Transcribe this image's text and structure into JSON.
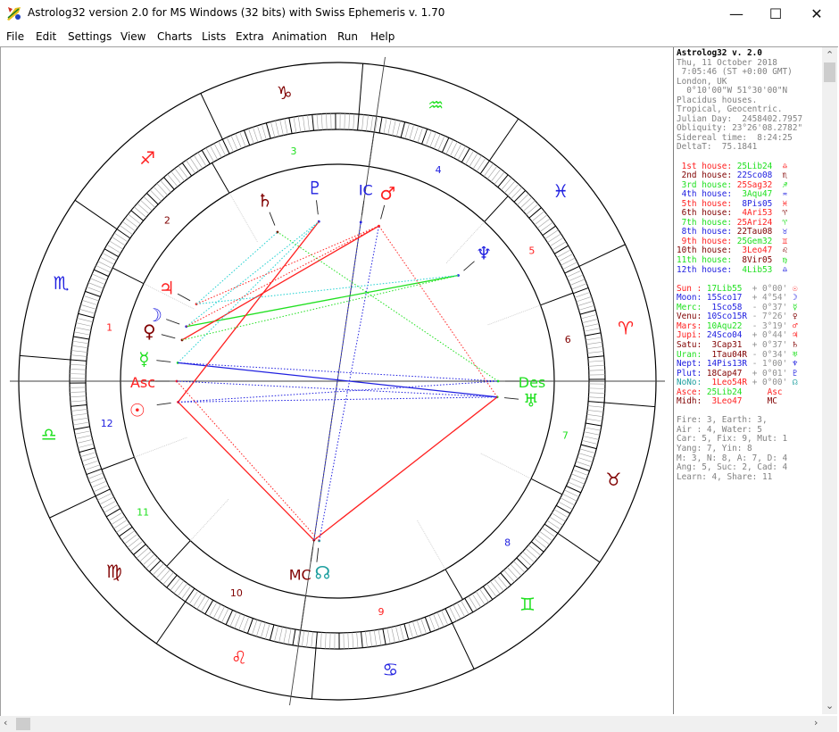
{
  "window": {
    "title": "Astrolog32 version 2.0 for MS Windows (32 bits) with Swiss Ephemeris v. 1.70",
    "controls": {
      "minimize": "—",
      "maximize": "☐",
      "close": "✕"
    }
  },
  "menu": [
    "File",
    "Edit",
    "Settings",
    "View",
    "Charts",
    "Lists",
    "Extra",
    "Animation",
    "Run",
    "Help"
  ],
  "info": {
    "header": [
      {
        "text": "Astrolog32 v. 2.0",
        "color": "#000000",
        "bold": true
      },
      {
        "text": "Thu, 11 October 2018",
        "color": "#808080"
      },
      {
        "text": " 7:05:46 (ST +0:00 GMT)",
        "color": "#808080"
      },
      {
        "text": "London, UK",
        "color": "#808080"
      },
      {
        "text": "  0°10'00\"W 51°30'00\"N",
        "color": "#808080"
      },
      {
        "text": "Placidus houses.",
        "color": "#808080"
      },
      {
        "text": "Tropical, Geocentric.",
        "color": "#808080"
      },
      {
        "text": "Julian Day:  2458402.7957",
        "color": "#808080"
      },
      {
        "text": "Obliquity: 23°26'08.2782\"",
        "color": "#808080"
      },
      {
        "text": "Sidereal time:  8:24:25",
        "color": "#808080"
      },
      {
        "text": "DeltaT:  75.1841",
        "color": "#808080"
      }
    ],
    "houses": [
      {
        "label": " 1st house:",
        "value": "25Lib24",
        "glyph": "♎",
        "lc": "#ff2020",
        "vc": "#20e020",
        "gc": "#ff2020"
      },
      {
        "label": " 2nd house:",
        "value": "22Sco08",
        "glyph": "♏",
        "lc": "#800000",
        "vc": "#2020e0",
        "gc": "#800000"
      },
      {
        "label": " 3rd house:",
        "value": "25Sag32",
        "glyph": "♐",
        "lc": "#20e020",
        "vc": "#ff2020",
        "gc": "#20e020"
      },
      {
        "label": " 4th house:",
        "value": " 3Aqu47",
        "glyph": "♒",
        "lc": "#2020e0",
        "vc": "#20e020",
        "gc": "#2020e0"
      },
      {
        "label": " 5th house:",
        "value": " 8Pis05",
        "glyph": "♓",
        "lc": "#ff2020",
        "vc": "#2020e0",
        "gc": "#ff2020"
      },
      {
        "label": " 6th house:",
        "value": " 4Ari53",
        "glyph": "♈",
        "lc": "#800000",
        "vc": "#ff2020",
        "gc": "#800000"
      },
      {
        "label": " 7th house:",
        "value": "25Ari24",
        "glyph": "♈",
        "lc": "#20e020",
        "vc": "#ff2020",
        "gc": "#20e020"
      },
      {
        "label": " 8th house:",
        "value": "22Tau08",
        "glyph": "♉",
        "lc": "#2020e0",
        "vc": "#800000",
        "gc": "#2020e0"
      },
      {
        "label": " 9th house:",
        "value": "25Gem32",
        "glyph": "♊",
        "lc": "#ff2020",
        "vc": "#20e020",
        "gc": "#ff2020"
      },
      {
        "label": "10th house:",
        "value": " 3Leo47",
        "glyph": "♌",
        "lc": "#800000",
        "vc": "#ff2020",
        "gc": "#800000"
      },
      {
        "label": "11th house:",
        "value": " 8Vir05",
        "glyph": "♍",
        "lc": "#20e020",
        "vc": "#800000",
        "gc": "#20e020"
      },
      {
        "label": "12th house:",
        "value": " 4Lib53",
        "glyph": "♎",
        "lc": "#2020e0",
        "vc": "#20e020",
        "gc": "#2020e0"
      }
    ],
    "planets": [
      {
        "label": "Sun :",
        "value": "17Lib55 ",
        "lat": "+ 0°00'",
        "glyph": "☉",
        "lc": "#ff2020",
        "vc": "#20e020"
      },
      {
        "label": "Moon:",
        "value": "15Sco17 ",
        "lat": "+ 4°54'",
        "glyph": "☽",
        "lc": "#2020e0",
        "vc": "#2020e0"
      },
      {
        "label": "Merc:",
        "value": " 1Sco58 ",
        "lat": "- 0°37'",
        "glyph": "☿",
        "lc": "#20e020",
        "vc": "#2020e0"
      },
      {
        "label": "Venu:",
        "value": "10Sco15R",
        "lat": "- 7°26'",
        "glyph": "♀",
        "lc": "#800000",
        "vc": "#2020e0"
      },
      {
        "label": "Mars:",
        "value": "10Aqu22 ",
        "lat": "- 3°19'",
        "glyph": "♂",
        "lc": "#ff2020",
        "vc": "#20e020"
      },
      {
        "label": "Jupi:",
        "value": "24Sco04 ",
        "lat": "+ 0°44'",
        "glyph": "♃",
        "lc": "#ff2020",
        "vc": "#2020e0"
      },
      {
        "label": "Satu:",
        "value": " 3Cap31 ",
        "lat": "+ 0°37'",
        "glyph": "♄",
        "lc": "#800000",
        "vc": "#800000"
      },
      {
        "label": "Uran:",
        "value": " 1Tau04R",
        "lat": "- 0°34'",
        "glyph": "♅",
        "lc": "#20e020",
        "vc": "#800000"
      },
      {
        "label": "Nept:",
        "value": "14Pis13R",
        "lat": "- 1°00'",
        "glyph": "♆",
        "lc": "#2020e0",
        "vc": "#2020e0"
      },
      {
        "label": "Plut:",
        "value": "18Cap47 ",
        "lat": "+ 0°01'",
        "glyph": "♇",
        "lc": "#2020e0",
        "vc": "#800000"
      },
      {
        "label": "NoNo:",
        "value": " 1Leo54R",
        "lat": "+ 0°00'",
        "glyph": "☊",
        "lc": "#20a0a0",
        "vc": "#ff2020"
      },
      {
        "label": "Asce:",
        "value": "25Lib24",
        "lat": "",
        "glyph": "Asc",
        "lc": "#ff2020",
        "vc": "#20e020"
      },
      {
        "label": "Midh:",
        "value": " 3Leo47",
        "lat": "",
        "glyph": "MC",
        "lc": "#800000",
        "vc": "#ff2020"
      }
    ],
    "summary": [
      "Fire: 3, Earth: 3,",
      "Air : 4, Water: 5",
      "Car: 5, Fix: 9, Mut: 1",
      "Yang: 7, Yin: 8",
      "M: 3, N: 8, A: 7, D: 4",
      "Ang: 5, Suc: 2, Cad: 4",
      "Learn: 4, Share: 11"
    ]
  },
  "wheel": {
    "ascendant_deg": 205.4,
    "house_cusps": [
      205.4,
      232.13,
      265.53,
      303.78,
      338.08,
      4.88,
      25.4,
      52.13,
      85.53,
      123.78,
      158.08,
      184.88
    ],
    "house_numbers": [
      "1",
      "2",
      "3",
      "4",
      "5",
      "6",
      "7",
      "8",
      "9",
      "10",
      "11",
      "12"
    ],
    "house_colors": [
      "#ff2020",
      "#800000",
      "#20e020",
      "#2020e0",
      "#ff2020",
      "#800000",
      "#20e020",
      "#2020e0",
      "#ff2020",
      "#800000",
      "#20e020",
      "#2020e0"
    ],
    "signs": [
      {
        "name": "aries",
        "glyph": "♈",
        "color": "#ff2020"
      },
      {
        "name": "taurus",
        "glyph": "♉",
        "color": "#800000"
      },
      {
        "name": "gemini",
        "glyph": "♊",
        "color": "#20e020"
      },
      {
        "name": "cancer",
        "glyph": "♋",
        "color": "#2020e0"
      },
      {
        "name": "leo",
        "glyph": "♌",
        "color": "#ff2020"
      },
      {
        "name": "virgo",
        "glyph": "♍",
        "color": "#800000"
      },
      {
        "name": "libra",
        "glyph": "♎",
        "color": "#20e020"
      },
      {
        "name": "scorpio",
        "glyph": "♏",
        "color": "#2020e0"
      },
      {
        "name": "sagittarius",
        "glyph": "♐",
        "color": "#ff2020"
      },
      {
        "name": "capricorn",
        "glyph": "♑",
        "color": "#800000"
      },
      {
        "name": "aquarius",
        "glyph": "♒",
        "color": "#20e020"
      },
      {
        "name": "pisces",
        "glyph": "♓",
        "color": "#2020e0"
      }
    ],
    "points": [
      {
        "name": "sun",
        "glyph": "☉",
        "lon": 197.92,
        "color": "#ff2020"
      },
      {
        "name": "moon",
        "glyph": "☽",
        "lon": 225.28,
        "color": "#2020e0"
      },
      {
        "name": "mercury",
        "glyph": "☿",
        "lon": 211.97,
        "color": "#20e020"
      },
      {
        "name": "venus",
        "glyph": "♀",
        "lon": 220.25,
        "color": "#800000"
      },
      {
        "name": "mars",
        "glyph": "♂",
        "lon": 310.37,
        "color": "#ff2020"
      },
      {
        "name": "jupiter",
        "glyph": "♃",
        "lon": 234.07,
        "color": "#ff2020"
      },
      {
        "name": "saturn",
        "glyph": "♄",
        "lon": 273.52,
        "color": "#800000"
      },
      {
        "name": "uranus",
        "glyph": "♅",
        "lon": 31.07,
        "color": "#20e020"
      },
      {
        "name": "neptune",
        "glyph": "♆",
        "lon": 344.22,
        "color": "#2020e0"
      },
      {
        "name": "pluto",
        "glyph": "♇",
        "lon": 288.78,
        "color": "#2020e0"
      },
      {
        "name": "north-node",
        "glyph": "☊",
        "lon": 121.9,
        "color": "#20a0a0"
      },
      {
        "name": "ascendant",
        "glyph": "Asc",
        "lon": 205.4,
        "color": "#ff2020"
      },
      {
        "name": "midheaven",
        "glyph": "MC",
        "lon": 123.78,
        "color": "#800000"
      },
      {
        "name": "descendant",
        "glyph": "Des",
        "lon": 25.4,
        "color": "#20e020"
      },
      {
        "name": "imum-coeli",
        "glyph": "IC",
        "lon": 303.78,
        "color": "#2020e0"
      }
    ],
    "aspects": [
      {
        "a": "midheaven",
        "b": "sun",
        "color": "#ff2020",
        "style": "solid"
      },
      {
        "a": "midheaven",
        "b": "uranus",
        "color": "#ff2020",
        "style": "solid"
      },
      {
        "a": "midheaven",
        "b": "imum-coeli",
        "color": "#2020e0",
        "style": "dot"
      },
      {
        "a": "north-node",
        "b": "mars",
        "color": "#2020e0",
        "style": "dot"
      },
      {
        "a": "mercury",
        "b": "uranus",
        "color": "#2020e0",
        "style": "solid"
      },
      {
        "a": "sun",
        "b": "uranus",
        "color": "#2020e0",
        "style": "dot"
      },
      {
        "a": "moon",
        "b": "neptune",
        "color": "#20e020",
        "style": "solid"
      },
      {
        "a": "sun",
        "b": "pluto",
        "color": "#ff2020",
        "style": "solid"
      },
      {
        "a": "venus",
        "b": "mars",
        "color": "#ff2020",
        "style": "solid"
      },
      {
        "a": "ascendant",
        "b": "north-node",
        "color": "#ff2020",
        "style": "dot"
      },
      {
        "a": "ascendant",
        "b": "uranus",
        "color": "#2020e0",
        "style": "dot"
      },
      {
        "a": "descendant",
        "b": "saturn",
        "color": "#20e020",
        "style": "dot"
      },
      {
        "a": "uranus",
        "b": "mars",
        "color": "#ff2020",
        "style": "dot"
      },
      {
        "a": "mercury",
        "b": "pluto",
        "color": "#20d0d0",
        "style": "dot"
      },
      {
        "a": "moon",
        "b": "pluto",
        "color": "#20d0d0",
        "style": "dot"
      },
      {
        "a": "jupiter",
        "b": "neptune",
        "color": "#20d0d0",
        "style": "dot"
      },
      {
        "a": "venus",
        "b": "neptune",
        "color": "#20e020",
        "style": "dot"
      },
      {
        "a": "moon",
        "b": "mars",
        "color": "#ff2020",
        "style": "dot"
      },
      {
        "a": "jupiter",
        "b": "mars",
        "color": "#ff2020",
        "style": "dot"
      },
      {
        "a": "mercury",
        "b": "descendant",
        "color": "#2020e0",
        "style": "dot"
      },
      {
        "a": "sun",
        "b": "descendant",
        "color": "#2020e0",
        "style": "dot"
      },
      {
        "a": "jupiter",
        "b": "saturn",
        "color": "#20d0d0",
        "style": "dot"
      }
    ]
  }
}
